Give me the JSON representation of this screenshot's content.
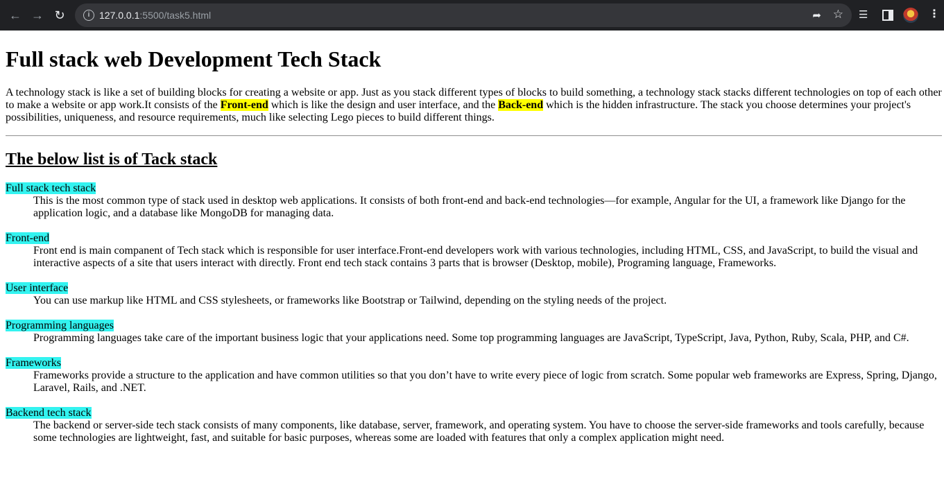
{
  "browser": {
    "url_host": "127.0.0.1",
    "url_rest": ":5500/task5.html"
  },
  "page": {
    "title": "Full stack web Development Tech Stack",
    "intro": {
      "part1": "A technology stack is like a set of building blocks for creating a website or app. Just as you stack different types of blocks to build something, a technology stack stacks different technologies on top of each other to make a website or app work.It consists of the ",
      "highlight1": "Front-end",
      "part2": " which is like the design and user interface, and the ",
      "highlight2": "Back-end",
      "part3": " which is the hidden infrastructure. The stack you choose determines your project's possibilities, uniqueness, and resource requirements, much like selecting Lego pieces to build different things."
    },
    "list_heading": "The below list is of Tack stack",
    "terms": [
      {
        "term": "Full stack tech stack",
        "definition": "This is the most common type of stack used in desktop web applications. It consists of both front-end and back-end technologies—for example, Angular for the UI, a framework like Django for the application logic, and a database like MongoDB for managing data."
      },
      {
        "term": "Front-end",
        "definition": "Front end is main companent of Tech stack which is responsible for user interface.Front-end developers work with various technologies, including HTML, CSS, and JavaScript, to build the visual and interactive aspects of a site that users interact with directly. Front end tech stack contains 3 parts that is browser (Desktop, mobile), Programing language, Frameworks."
      },
      {
        "term": "User interface",
        "definition": "You can use markup like HTML and CSS stylesheets, or frameworks like Bootstrap or Tailwind, depending on the styling needs of the project."
      },
      {
        "term": "Programming languages",
        "definition": "Programming languages take care of the important business logic that your applications need. Some top programming languages are JavaScript, TypeScript, Java, Python, Ruby, Scala, PHP, and C#."
      },
      {
        "term": "Frameworks",
        "definition": "Frameworks provide a structure to the application and have common utilities so that you don’t have to write every piece of logic from scratch. Some popular web frameworks are Express, Spring, Django, Laravel, Rails, and .NET."
      },
      {
        "term": "Backend tech stack",
        "definition": "The backend or server-side tech stack consists of many components, like database, server, framework, and operating system. You have to choose the server-side frameworks and tools carefully, because some technologies are lightweight, fast, and suitable for basic purposes, whereas some are loaded with features that only a complex application might need."
      }
    ]
  },
  "colors": {
    "term_highlight": "#33f3f0",
    "inline_highlight": "#ffff00",
    "chrome_bg": "#202124"
  },
  "icons": [
    "back-arrow-icon",
    "forward-arrow-icon",
    "reload-icon",
    "site-info-icon",
    "share-icon",
    "bookmark-star-icon",
    "media-control-icon",
    "side-panel-icon",
    "profile-avatar-icon",
    "menu-kebab-icon"
  ]
}
